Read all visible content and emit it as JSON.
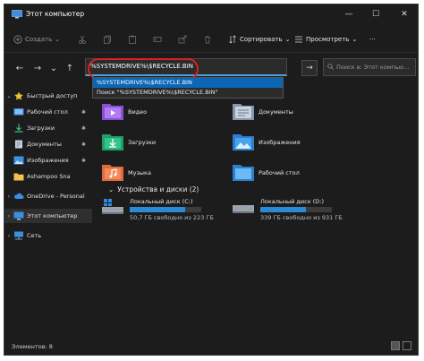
{
  "window": {
    "title": "Этот компьютер",
    "minimize_glyph": "—",
    "maximize_glyph": "☐",
    "close_glyph": "✕"
  },
  "toolbar": {
    "create_label": "Создать",
    "sort_label": "Сортировать",
    "view_label": "Просмотреть",
    "more_label": "···"
  },
  "nav": {
    "back": "←",
    "forward": "→",
    "up": "↑",
    "dropdown": "⌄",
    "go": "→"
  },
  "address": {
    "value": "%SYSTEMDRIVE%\\$RECYCLE.BIN",
    "suggestions": [
      "%SYSTEMDRIVE%\\$RECYCLE.BIN",
      "Поиск \"%SYSTEMDRIVE%\\$RECYCLE.BIN\""
    ]
  },
  "search": {
    "placeholder": "Поиск в: Этот компью..."
  },
  "sidebar": {
    "items": [
      {
        "label": "Быстрый доступ",
        "icon": "star-icon"
      },
      {
        "label": "Рабочий стол",
        "icon": "desktop-icon"
      },
      {
        "label": "Загрузки",
        "icon": "download-icon"
      },
      {
        "label": "Документы",
        "icon": "documents-icon"
      },
      {
        "label": "Изображения",
        "icon": "pictures-icon"
      },
      {
        "label": "Ashampoo Sna",
        "icon": "folder-icon"
      },
      {
        "label": "OneDrive - Personal",
        "icon": "cloud-icon"
      },
      {
        "label": "Этот компьютер",
        "icon": "computer-icon"
      },
      {
        "label": "Сеть",
        "icon": "network-icon"
      }
    ]
  },
  "folders": [
    {
      "label": "Видео",
      "icon": "video-folder-icon"
    },
    {
      "label": "Документы",
      "icon": "documents-folder-icon"
    },
    {
      "label": "Загрузки",
      "icon": "downloads-folder-icon"
    },
    {
      "label": "Изображения",
      "icon": "pictures-folder-icon"
    },
    {
      "label": "Музыка",
      "icon": "music-folder-icon"
    },
    {
      "label": "Рабочий стол",
      "icon": "desktop-folder-icon"
    }
  ],
  "devices": {
    "title": "Устройства и диски (2)",
    "drives": [
      {
        "label": "Локальный диск (C:)",
        "free": "50,7 ГБ свободно из 223 ГБ",
        "used_fraction": 0.77
      },
      {
        "label": "Локальный диск (D:)",
        "free": "339 ГБ свободно из 931 ГБ",
        "used_fraction": 0.64
      }
    ]
  },
  "status": {
    "items": "Элементов: 8"
  },
  "colors": {
    "accent": "#0b66b8",
    "highlight": "#e02020",
    "background": "#1c1c1c"
  }
}
